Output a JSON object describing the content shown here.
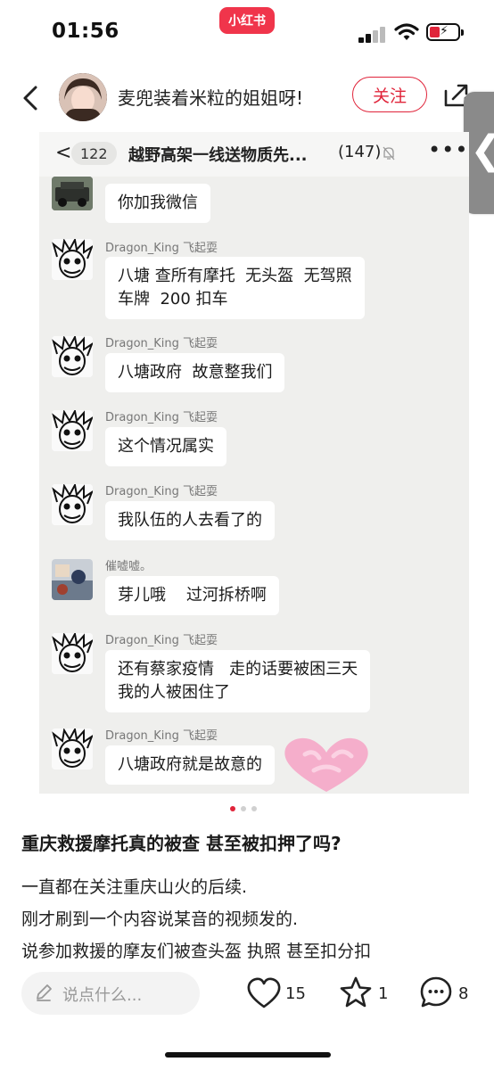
{
  "status_bar": {
    "time": "01:56",
    "brand": "小红书",
    "battery_color": "#e0243a"
  },
  "header": {
    "author_name": "麦兜装着米粒的姐姐呀!",
    "follow_label": "关注",
    "back_icon": "chevron-left-icon",
    "share_icon": "share-icon"
  },
  "side_tab": {
    "glyph": "❮"
  },
  "chat_photo": {
    "back_glyph": "<",
    "unread_count": "122",
    "group_title": "越野高架一线送物质先...",
    "member_count": "(147)",
    "more_glyph": "•••",
    "messages": [
      {
        "sender": "",
        "text": "你加我微信",
        "avatar": "vehicle"
      },
      {
        "sender": "Dragon_King 飞起耍",
        "text": "八塘 查所有摩托  无头盔  无驾照\n车牌  200 扣车",
        "avatar": "sketch"
      },
      {
        "sender": "Dragon_King 飞起耍",
        "text": "八塘政府  故意整我们",
        "avatar": "sketch"
      },
      {
        "sender": "Dragon_King 飞起耍",
        "text": "这个情况属实",
        "avatar": "sketch"
      },
      {
        "sender": "Dragon_King 飞起耍",
        "text": "我队伍的人去看了的",
        "avatar": "sketch"
      },
      {
        "sender": "催嘘嘘。",
        "text": "芽儿哦    过河拆桥啊",
        "avatar": "photo"
      },
      {
        "sender": "Dragon_King 飞起耍",
        "text": "还有蔡家疫情   走的话要被困三天\n我的人被困住了",
        "avatar": "sketch"
      },
      {
        "sender": "Dragon_King 飞起耍",
        "text": "八塘政府就是故意的",
        "avatar": "sketch"
      }
    ],
    "sticker_color": "#f5a8c8"
  },
  "carousel": {
    "active_index": 0,
    "count": 3,
    "active_color": "#e0243a"
  },
  "post": {
    "title": "重庆救援摩托真的被查 甚至被扣押了吗?",
    "lines": [
      "一直都在关注重庆山火的后续.",
      "刚才刷到一个内容说某音的视频发的.",
      "说参加救援的摩友们被查头盔 执照 甚至扣分扣"
    ]
  },
  "bottom_bar": {
    "comment_placeholder": "说点什么...",
    "likes": "15",
    "collects": "1",
    "comments": "8"
  }
}
